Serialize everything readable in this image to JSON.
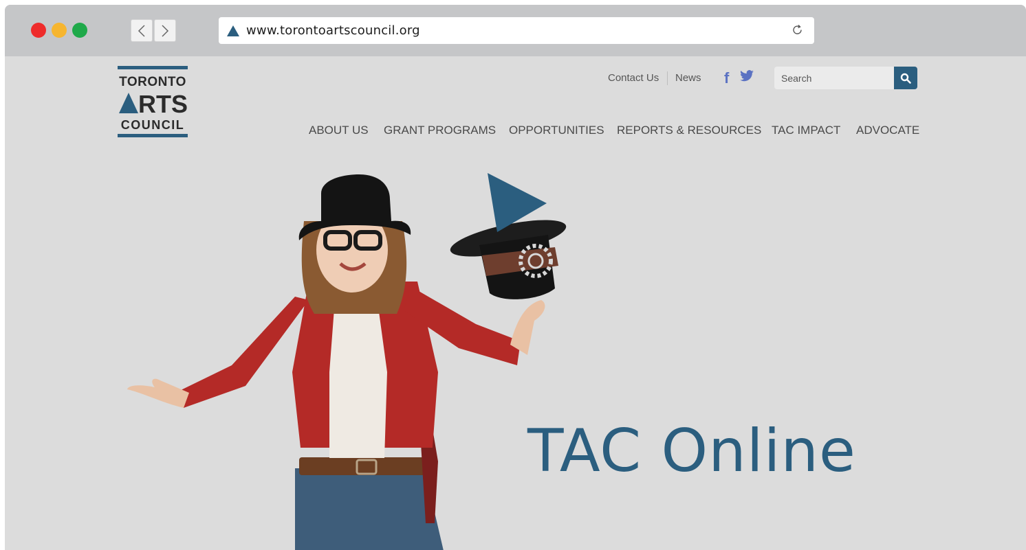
{
  "browser": {
    "url": "www.torontoartscouncil.org",
    "back_label": "<",
    "forward_label": ">",
    "reload_icon": "reload-icon"
  },
  "header": {
    "logo": {
      "line1": "TORONTO",
      "line2": "RTS",
      "line3": "COUNCIL"
    },
    "top_links": {
      "contact": "Contact Us",
      "news": "News"
    },
    "social": {
      "facebook": "f",
      "twitter": "twitter-icon"
    },
    "search": {
      "placeholder": "Search"
    },
    "nav": [
      {
        "label": "ABOUT US"
      },
      {
        "label": "GRANT PROGRAMS"
      },
      {
        "label": "OPPORTUNITIES"
      },
      {
        "label": "REPORTS & RESOURCES"
      },
      {
        "label": "TAC IMPACT"
      },
      {
        "label": "ADVOCATE"
      }
    ]
  },
  "hero": {
    "headline": "TAC Online",
    "accent_color": "#2b5e7f"
  }
}
